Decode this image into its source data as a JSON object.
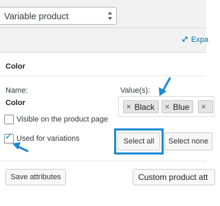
{
  "product_type": {
    "selected": "Variable product"
  },
  "expand": {
    "label": "Expa"
  },
  "attribute": {
    "heading": "Color",
    "name_label": "Name:",
    "name_value": "Color",
    "values_label": "Value(s):",
    "values": [
      "Black",
      "Blue",
      ""
    ],
    "tag_remove_symbol": "×",
    "visible_on_product_page": {
      "label": "Visible on the product page",
      "checked": false
    },
    "used_for_variations": {
      "label": "Used for variations",
      "checked": true,
      "check_symbol": "✓"
    },
    "select_all_label": "Select all",
    "select_none_label": "Select none"
  },
  "footer": {
    "save_label": "Save attributes",
    "custom_attribute_label": "Custom product att"
  },
  "colors": {
    "highlight": "#1b8ad3",
    "arrow": "#1b8ad3",
    "link": "#0073aa",
    "panel_background": "#f1f1f1"
  },
  "icons": [
    "select-arrows-icon",
    "expand-icon",
    "remove-icon",
    "checkmark-icon",
    "pointer-arrow-icon"
  ]
}
